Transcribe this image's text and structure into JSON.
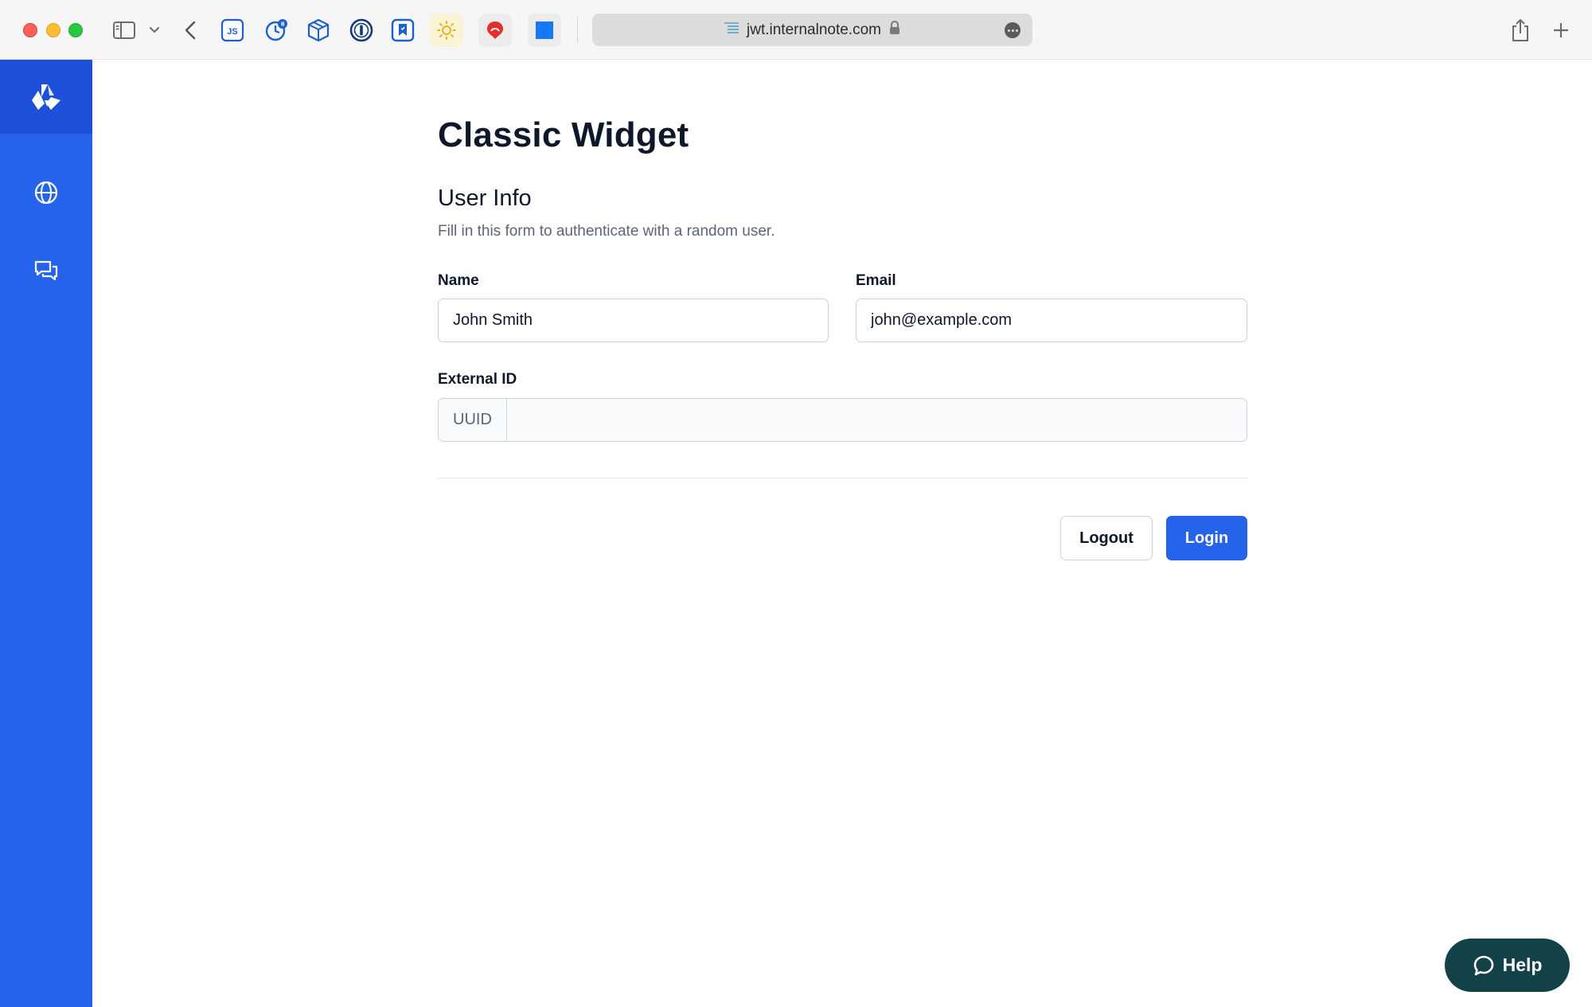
{
  "browser": {
    "url": "jwt.internalnote.com",
    "extensions": [
      "js-extension-icon",
      "clock-badge-icon",
      "package-cube-icon",
      "password-manager-icon",
      "bookmark-icon",
      "sun-icon",
      "raindrop-icon",
      "blue-square-icon"
    ]
  },
  "sidebar": {
    "items": [
      {
        "name": "globe",
        "icon": "globe-icon"
      },
      {
        "name": "chat",
        "icon": "chat-bubbles-icon"
      }
    ]
  },
  "page": {
    "title": "Classic Widget"
  },
  "form": {
    "section_title": "User Info",
    "section_description": "Fill in this form to authenticate with a random user.",
    "name_label": "Name",
    "name_value": "John Smith",
    "email_label": "Email",
    "email_value": "john@example.com",
    "external_id_label": "External ID",
    "external_id_prefix": "UUID",
    "external_id_value": ""
  },
  "actions": {
    "logout_label": "Logout",
    "login_label": "Login"
  },
  "help": {
    "label": "Help"
  },
  "colors": {
    "primary": "#2563eb",
    "sidebar_logo_bg": "#1d4fd8",
    "help_bg": "#124148"
  }
}
